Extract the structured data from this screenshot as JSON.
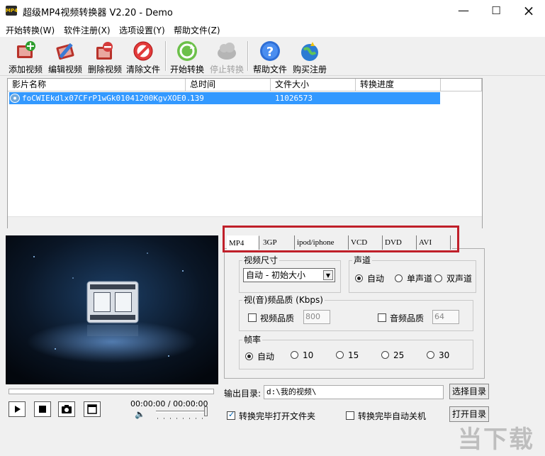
{
  "window": {
    "title": "超级MP4视频转换器 V2.20 - Demo",
    "app_icon_text": "MP4"
  },
  "menu": {
    "items": [
      "开始转换(W)",
      "软件注册(X)",
      "选项设置(Y)",
      "帮助文件(Z)"
    ]
  },
  "toolbar": {
    "buttons": [
      {
        "label": "添加视频",
        "icon": "add-video-icon",
        "enabled": true
      },
      {
        "label": "编辑视频",
        "icon": "edit-video-icon",
        "enabled": true
      },
      {
        "label": "删除视频",
        "icon": "delete-video-icon",
        "enabled": true
      },
      {
        "label": "清除文件",
        "icon": "clear-files-icon",
        "enabled": true
      },
      {
        "label": "开始转换",
        "icon": "start-convert-icon",
        "enabled": true
      },
      {
        "label": "停止转换",
        "icon": "stop-convert-icon",
        "enabled": false
      },
      {
        "label": "帮助文件",
        "icon": "help-icon",
        "enabled": true
      },
      {
        "label": "购买注册",
        "icon": "purchase-icon",
        "enabled": true
      }
    ]
  },
  "file_list": {
    "columns": [
      "影片名称",
      "总时间",
      "文件大小",
      "转换进度"
    ],
    "rows": [
      {
        "name": "foCWIEkdlx07CFrP1wGk01041200KgvXOE0...",
        "duration": "139",
        "size": "11026573",
        "progress": ""
      }
    ]
  },
  "player": {
    "time": "00:00:00 / 00:00:00",
    "controls": [
      "play-icon",
      "stop-icon",
      "snapshot-icon",
      "fullscreen-icon"
    ],
    "volume_level": 1.0
  },
  "tabs": {
    "items": [
      "MP4",
      "3GP",
      "ipod/iphone",
      "VCD",
      "DVD",
      "AVI"
    ],
    "active": "MP4",
    "highlight_color": "#c0202a"
  },
  "video_size": {
    "title": "视频尺寸",
    "selected": "自动 - 初始大小"
  },
  "audio_channel": {
    "title": "声道",
    "options": [
      "自动",
      "单声道",
      "双声道"
    ],
    "selected": "自动"
  },
  "quality": {
    "title": "视(音)频品质 (Kbps)",
    "video_label": "视频品质",
    "video_checked": false,
    "video_value": "800",
    "audio_label": "音频品质",
    "audio_checked": false,
    "audio_value": "64"
  },
  "framerate": {
    "title": "帧率",
    "options": [
      "自动",
      "10",
      "15",
      "25",
      "30"
    ],
    "selected": "自动"
  },
  "output": {
    "dir_label": "输出目录:",
    "dir_value": "d:\\我的视频\\",
    "choose_button": "选择目录",
    "open_button": "打开目录",
    "open_folder_after": {
      "label": "转换完毕打开文件夹",
      "checked": true
    },
    "shutdown_after": {
      "label": "转换完毕自动关机",
      "checked": false
    }
  },
  "watermark": "当下载吧"
}
